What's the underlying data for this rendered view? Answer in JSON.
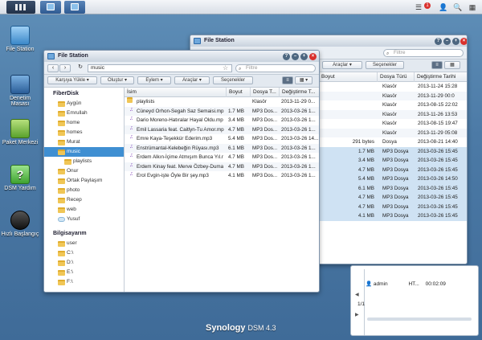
{
  "taskbar": {
    "notification_count": "1"
  },
  "desktop_icons": [
    {
      "label": "File Station"
    },
    {
      "label": "Denetim Masası"
    },
    {
      "label": "Paket Merkezi"
    },
    {
      "label": "DSM Yardım"
    },
    {
      "label": "Hızlı Başlangıç"
    }
  ],
  "back_window": {
    "title": "File Station",
    "search_placeholder": "Filtre",
    "toolbar": [
      "Araçlar",
      "Seçenekler"
    ],
    "columns": [
      "Boyut",
      "Dosya Türü",
      "Değiştirme Tarihi"
    ],
    "rows": [
      {
        "name": "",
        "size": "",
        "type": "Klasör",
        "date": "2013-11-24 15:28"
      },
      {
        "name": "",
        "size": "",
        "type": "Klasör",
        "date": "2013-11-29 00:0"
      },
      {
        "name": "",
        "size": "",
        "type": "Klasör",
        "date": "2013-08-15 22:02"
      },
      {
        "name": "",
        "size": "",
        "type": "Klasör",
        "date": "2013-11-26 13:53"
      },
      {
        "name": "",
        "size": "",
        "type": "Klasör",
        "date": "2013-08-15 19:47"
      },
      {
        "name": "",
        "size": "",
        "type": "Klasör",
        "date": "2013-11-29 05:08"
      },
      {
        "name": "",
        "size": "291 bytes",
        "type": "Dosya",
        "date": "2013-08-21 14:40"
      },
      {
        "name": "Segah Saz Sem",
        "size": "1.7 MB",
        "type": "MP3 Dosya",
        "date": "2013-03-26 15:45"
      },
      {
        "name": "hatralar Hayal C",
        "size": "3.4 MB",
        "type": "MP3 Dosya",
        "date": "2013-03-26 15:45"
      },
      {
        "name": "feat. Caitlyn-Tu",
        "size": "4.7 MB",
        "type": "MP3 Dosya",
        "date": "2013-03-26 15:45"
      },
      {
        "name": "Teşekkür Ederim",
        "size": "5.4 MB",
        "type": "MP3 Dosya",
        "date": "2013-03-26 14:50"
      },
      {
        "name": "Kelebeğin Rüyası",
        "size": "6.1 MB",
        "type": "MP3 Dosya",
        "date": "2013-03-26 15:45"
      },
      {
        "name": "-İçime Atmışım Bun",
        "size": "4.7 MB",
        "type": "MP3 Dosya",
        "date": "2013-03-26 15:45"
      },
      {
        "name": "feat. Merve Özbey",
        "size": "4.7 MB",
        "type": "MP3 Dosya",
        "date": "2013-03-26 15:45"
      },
      {
        "name": "Öyle Bir şey.mp3",
        "size": "4.1 MB",
        "type": "MP3 Dosya",
        "date": "2013-03-26 15:45"
      }
    ]
  },
  "front_window": {
    "title": "File Station",
    "path": "music",
    "search_placeholder": "Filtre",
    "toolbar": [
      "Karşıya Yükle",
      "Oluştur",
      "Eylem",
      "Araçlar",
      "Seçenekler"
    ],
    "sidebar": {
      "section1": "FiberDisk",
      "items": [
        "Aygün",
        "Emrullah",
        "home",
        "homes",
        "Murat",
        "music",
        "playlists",
        "Onur",
        "Ortak Paylaşım",
        "photo",
        "Recep",
        "web",
        "Yusuf"
      ],
      "section2": "Bilgisayarım",
      "items2": [
        "user",
        "C:\\",
        "D:\\",
        "E:\\",
        "F:\\"
      ]
    },
    "columns": [
      "İsim",
      "Boyut",
      "Dosya T...",
      "Değiştirme T..."
    ],
    "rows": [
      {
        "name": "playlists",
        "size": "",
        "type": "Klasör",
        "date": "2013-11-29 0..."
      },
      {
        "name": "Cüneyd Orhon-Segah Saz Semaisi.mp",
        "size": "1.7 MB",
        "type": "MP3 Dos...",
        "date": "2013-03-26 1..."
      },
      {
        "name": "Dario Moreno-Hatıralar Hayal Oldu.mp",
        "size": "3.4 MB",
        "type": "MP3 Dos...",
        "date": "2013-03-26 1..."
      },
      {
        "name": "Emil Lassaria feat. Caitlyn-Tu Amor.mp",
        "size": "4.7 MB",
        "type": "MP3 Dos...",
        "date": "2013-03-26 1..."
      },
      {
        "name": "Emre Kaya-Teşekkür Ederim.mp3",
        "size": "5.4 MB",
        "type": "MP3 Dos...",
        "date": "2013-03-26 14..."
      },
      {
        "name": "Enstrümantal-Kelebeğin Rüyası.mp3",
        "size": "6.1 MB",
        "type": "MP3 Dos...",
        "date": "2013-03-26 1..."
      },
      {
        "name": "Erdem Alkın-İçime Atmışım Bunca Yıl.r",
        "size": "4.7 MB",
        "type": "MP3 Dos...",
        "date": "2013-03-26 1..."
      },
      {
        "name": "Erdem Kinay feat. Merve Özbey-Duma",
        "size": "4.7 MB",
        "type": "MP3 Dos...",
        "date": "2013-03-26 1..."
      },
      {
        "name": "Erol Evgin-işte Öyle Bir şey.mp3",
        "size": "4.1 MB",
        "type": "MP3 Dos...",
        "date": "2013-03-26 1..."
      }
    ]
  },
  "widget": {
    "user": "admin",
    "protocol": "HT...",
    "time": "00:02:09",
    "page": "1/1"
  },
  "brand": {
    "name": "Synology",
    "version": "DSM 4.3"
  }
}
